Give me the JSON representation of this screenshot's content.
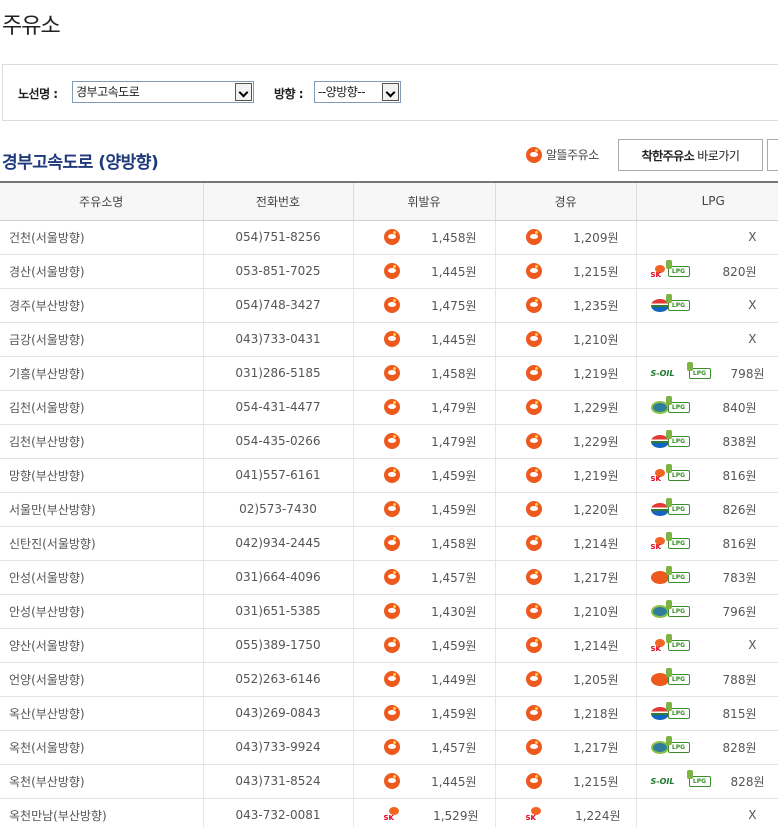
{
  "page": {
    "title": "주유소"
  },
  "filter": {
    "route_label": "노선명 :",
    "route_value": "경부고속도로",
    "direction_label": "방향 :",
    "direction_value": "--양방향--"
  },
  "section": {
    "title": "경부고속도로 (양방향)",
    "legend_label": "알뜰주유소",
    "good_button_bold": "착한주유소",
    "good_button_rest": "바로가기"
  },
  "colors": {
    "title_blue": "#1f3a7a",
    "alttul_orange": "#ee5a1e",
    "lpg_green": "#3a8e2c"
  },
  "table": {
    "headers": [
      "주유소명",
      "전화번호",
      "휘발유",
      "경유",
      "LPG"
    ],
    "rows": [
      {
        "name": "건천(서울방향)",
        "tel": "054)751-8256",
        "gas_brand": "alttul-icon",
        "gasoline": "1,458원",
        "diesel_brand": "alttul-icon",
        "diesel": "1,209원",
        "lpg_brand": "",
        "lpg": "X"
      },
      {
        "name": "경산(서울방향)",
        "tel": "053-851-7025",
        "gas_brand": "alttul-icon",
        "gasoline": "1,445원",
        "diesel_brand": "alttul-icon",
        "diesel": "1,215원",
        "lpg_brand": "sk",
        "lpg": "820원"
      },
      {
        "name": "경주(부산방향)",
        "tel": "054)748-3427",
        "gas_brand": "alttul-icon",
        "gasoline": "1,475원",
        "diesel_brand": "alttul-icon",
        "diesel": "1,235원",
        "lpg_brand": "oilbank",
        "lpg": "X"
      },
      {
        "name": "금강(서울방향)",
        "tel": "043)733-0431",
        "gas_brand": "alttul-icon",
        "gasoline": "1,445원",
        "diesel_brand": "alttul-icon",
        "diesel": "1,210원",
        "lpg_brand": "",
        "lpg": "X"
      },
      {
        "name": "기흥(부산방향)",
        "tel": "031)286-5185",
        "gas_brand": "alttul-icon",
        "gasoline": "1,458원",
        "diesel_brand": "alttul-icon",
        "diesel": "1,219원",
        "lpg_brand": "s-oil",
        "lpg": "798원"
      },
      {
        "name": "김천(서울방향)",
        "tel": "054-431-4477",
        "gas_brand": "alttul-icon",
        "gasoline": "1,479원",
        "diesel_brand": "alttul-icon",
        "diesel": "1,229원",
        "lpg_brand": "hyundai",
        "lpg": "840원"
      },
      {
        "name": "김천(부산방향)",
        "tel": "054-435-0266",
        "gas_brand": "alttul-icon",
        "gasoline": "1,479원",
        "diesel_brand": "alttul-icon",
        "diesel": "1,229원",
        "lpg_brand": "oilbank",
        "lpg": "838원"
      },
      {
        "name": "망향(부산방향)",
        "tel": "041)557-6161",
        "gas_brand": "alttul-icon",
        "gasoline": "1,459원",
        "diesel_brand": "alttul-icon",
        "diesel": "1,219원",
        "lpg_brand": "sk",
        "lpg": "816원"
      },
      {
        "name": "서울만(부산방향)",
        "tel": "02)573-7430",
        "gas_brand": "alttul-icon",
        "gasoline": "1,459원",
        "diesel_brand": "alttul-icon",
        "diesel": "1,220원",
        "lpg_brand": "oilbank",
        "lpg": "826원"
      },
      {
        "name": "신탄진(서울방향)",
        "tel": "042)934-2445",
        "gas_brand": "alttul-icon",
        "gasoline": "1,458원",
        "diesel_brand": "alttul-icon",
        "diesel": "1,214원",
        "lpg_brand": "sk",
        "lpg": "816원"
      },
      {
        "name": "안성(서울방향)",
        "tel": "031)664-4096",
        "gas_brand": "alttul-icon",
        "gasoline": "1,457원",
        "diesel_brand": "alttul-icon",
        "diesel": "1,217원",
        "lpg_brand": "gs",
        "lpg": "783원"
      },
      {
        "name": "안성(부산방향)",
        "tel": "031)651-5385",
        "gas_brand": "alttul-icon",
        "gasoline": "1,430원",
        "diesel_brand": "alttul-icon",
        "diesel": "1,210원",
        "lpg_brand": "hyundai",
        "lpg": "796원"
      },
      {
        "name": "양산(서울방향)",
        "tel": "055)389-1750",
        "gas_brand": "alttul-icon",
        "gasoline": "1,459원",
        "diesel_brand": "alttul-icon",
        "diesel": "1,214원",
        "lpg_brand": "sk",
        "lpg": "X"
      },
      {
        "name": "언양(서울방향)",
        "tel": "052)263-6146",
        "gas_brand": "alttul-icon",
        "gasoline": "1,449원",
        "diesel_brand": "alttul-icon",
        "diesel": "1,205원",
        "lpg_brand": "gs",
        "lpg": "788원"
      },
      {
        "name": "옥산(부산방향)",
        "tel": "043)269-0843",
        "gas_brand": "alttul-icon",
        "gasoline": "1,459원",
        "diesel_brand": "alttul-icon",
        "diesel": "1,218원",
        "lpg_brand": "oilbank",
        "lpg": "815원"
      },
      {
        "name": "옥천(서울방향)",
        "tel": "043)733-9924",
        "gas_brand": "alttul-icon",
        "gasoline": "1,457원",
        "diesel_brand": "alttul-icon",
        "diesel": "1,217원",
        "lpg_brand": "hyundai",
        "lpg": "828원"
      },
      {
        "name": "옥천(부산방향)",
        "tel": "043)731-8524",
        "gas_brand": "alttul-icon",
        "gasoline": "1,445원",
        "diesel_brand": "alttul-icon",
        "diesel": "1,215원",
        "lpg_brand": "s-oil",
        "lpg": "828원"
      },
      {
        "name": "옥천만남(부산방향)",
        "tel": "043-732-0081",
        "gas_brand": "sk-icon",
        "gasoline": "1,529원",
        "diesel_brand": "sk-icon",
        "diesel": "1,224원",
        "lpg_brand": "",
        "lpg": "X"
      }
    ]
  }
}
